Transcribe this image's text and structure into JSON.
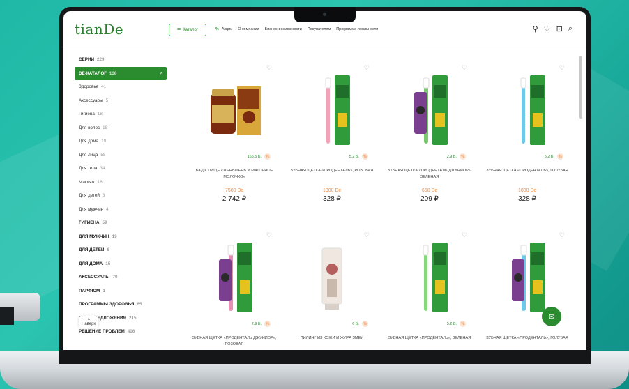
{
  "header": {
    "logo": "tianDe",
    "catalog_label": "Каталог",
    "nav": [
      "Акции",
      "О компании",
      "Бизнес-возможности",
      "Покупателям",
      "Программа лояльности"
    ],
    "icons": [
      "user-icon",
      "heart-icon",
      "bag-icon",
      "search-icon"
    ]
  },
  "sidebar": {
    "items": [
      {
        "label": "СЕРИИ",
        "count": "229",
        "style": "upper"
      },
      {
        "label": "DE-КАТАЛОГ",
        "count": "138",
        "style": "active"
      },
      {
        "label": "Здоровье",
        "count": "41",
        "style": "sub"
      },
      {
        "label": "Аксессуары",
        "count": "5",
        "style": "sub"
      },
      {
        "label": "Гигиена",
        "count": "18",
        "style": "sub"
      },
      {
        "label": "Для волос",
        "count": "18",
        "style": "sub"
      },
      {
        "label": "Для дома",
        "count": "10",
        "style": "sub"
      },
      {
        "label": "Для лица",
        "count": "58",
        "style": "sub"
      },
      {
        "label": "Для тела",
        "count": "34",
        "style": "sub"
      },
      {
        "label": "Макияж",
        "count": "16",
        "style": "sub"
      },
      {
        "label": "Для детей",
        "count": "3",
        "style": "sub"
      },
      {
        "label": "Для мужчин",
        "count": "4",
        "style": "sub"
      },
      {
        "label": "ГИГИЕНА",
        "count": "59",
        "style": "upper"
      },
      {
        "label": "ДЛЯ МУЖЧИН",
        "count": "19",
        "style": "upper"
      },
      {
        "label": "ДЛЯ ДЕТЕЙ",
        "count": "6",
        "style": "upper"
      },
      {
        "label": "ДЛЯ ДОМА",
        "count": "15",
        "style": "upper"
      },
      {
        "label": "АКСЕССУАРЫ",
        "count": "70",
        "style": "upper"
      },
      {
        "label": "ПАРФЮМ",
        "count": "1",
        "style": "upper"
      },
      {
        "label": "ПРОГРАММЫ ЗДОРОВЬЯ",
        "count": "65",
        "style": "upper"
      },
      {
        "label": "СПЕЦПРЕДЛОЖЕНИЯ",
        "count": "215",
        "style": "upper"
      },
      {
        "label": "РЕШЕНИЕ ПРОБЛЕМ",
        "count": "406",
        "style": "upper"
      }
    ],
    "back_to_top": "Наверх"
  },
  "products": [
    {
      "title": "БАД К ПИЩЕ «ЖЕНЬШЕНЬ И МАТОЧНОЕ МОЛОЧКО»",
      "points": "165.5 Б.",
      "dc": "7500 Dc",
      "price": "2 742 ₽",
      "kind": "bottle"
    },
    {
      "title": "ЗУБНАЯ ЩЕТКА «ПРОДЕНТАЛЬ», РОЗОВАЯ",
      "points": "5.2 Б.",
      "dc": "1000 Dc",
      "price": "328 ₽",
      "kind": "brush",
      "color": "#f2a3b8"
    },
    {
      "title": "ЗУБНАЯ ЩЕТКА «ПРОДЕНТАЛЬ ДЖУНИОР», ЗЕЛЕНАЯ",
      "points": "2.9 Б.",
      "dc": "650 Dc",
      "price": "209 ₽",
      "kind": "junior",
      "color": "#7bc96f"
    },
    {
      "title": "ЗУБНАЯ ЩЕТКА «ПРОДЕНТАЛЬ», ГОЛУБАЯ",
      "points": "5.2 Б.",
      "dc": "1000 Dc",
      "price": "328 ₽",
      "kind": "brush",
      "color": "#6fc8e6"
    },
    {
      "title": "ЗУБНАЯ ЩЕТКА «ПРОДЕНТАЛЬ ДЖУНИОР», РОЗОВАЯ",
      "points": "2.9 Б.",
      "dc": "",
      "price": "",
      "kind": "junior",
      "color": "#e58fb2"
    },
    {
      "title": "ПИЛИНГ ИЗ КОЖИ И ЖИРА ЗМЕИ",
      "points": "6 Б.",
      "dc": "",
      "price": "",
      "kind": "tube"
    },
    {
      "title": "ЗУБНАЯ ЩЕТКА «ПРОДЕНТАЛЬ», ЗЕЛЕНАЯ",
      "points": "5.2 Б.",
      "dc": "",
      "price": "",
      "kind": "brush",
      "color": "#86d97a"
    },
    {
      "title": "ЗУБНАЯ ЩЕТКА «ПРОДЕНТАЛЬ», ГОЛУБАЯ",
      "points": "",
      "dc": "",
      "price": "",
      "kind": "junior",
      "color": "#6fc8e6"
    }
  ],
  "colors": {
    "brand": "#2a8b2f",
    "dc": "#f08a3c"
  }
}
